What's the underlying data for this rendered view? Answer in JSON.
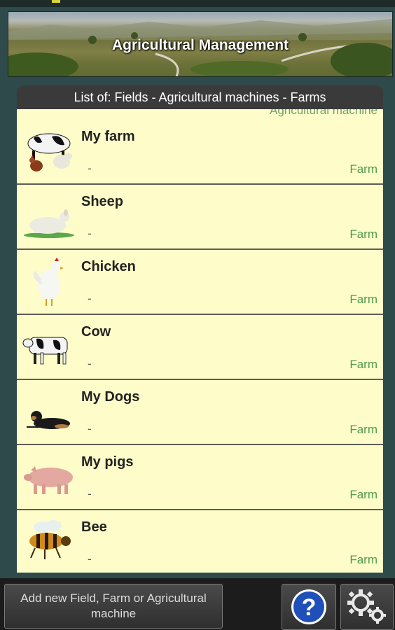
{
  "banner": {
    "title": "Agricultural Management"
  },
  "list": {
    "header": "List of: Fields - Agricultural machines - Farms",
    "partial_label": "Agricultural machine",
    "items": [
      {
        "name": "My farm",
        "sub": "-",
        "type": "Farm",
        "icon": "farm-animals-icon"
      },
      {
        "name": "Sheep",
        "sub": "-",
        "type": "Farm",
        "icon": "sheep-icon"
      },
      {
        "name": "Chicken",
        "sub": "-",
        "type": "Farm",
        "icon": "chicken-icon"
      },
      {
        "name": "Cow",
        "sub": "-",
        "type": "Farm",
        "icon": "cow-icon"
      },
      {
        "name": "My Dogs",
        "sub": "-",
        "type": "Farm",
        "icon": "dog-icon"
      },
      {
        "name": "My pigs",
        "sub": "-",
        "type": "Farm",
        "icon": "pig-icon"
      },
      {
        "name": "Bee",
        "sub": "-",
        "type": "Farm",
        "icon": "bee-icon"
      }
    ]
  },
  "bottom_bar": {
    "add_label": "Add new Field, Farm or Agricultural machine",
    "help_icon": "help-icon",
    "settings_icon": "settings-gears-icon"
  },
  "colors": {
    "background": "#2e4a4a",
    "row_background": "#fefdc9",
    "type_text": "#4f9a4f",
    "header_background": "#3a3a3a"
  }
}
